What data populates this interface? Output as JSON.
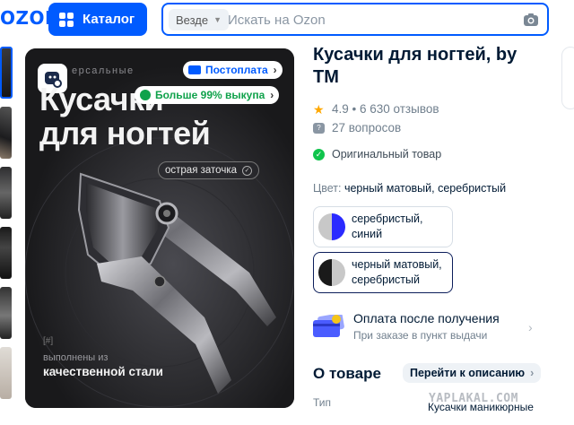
{
  "header": {
    "logo": "OZON",
    "catalog_label": "Каталог",
    "search_scope": "Везде",
    "search_placeholder": "Искать на Ozon"
  },
  "hero": {
    "subtitle": "ерсальные",
    "title_line1": "Кусачки",
    "title_line2": "для ногтей",
    "postpay_badge": "Постоплата",
    "buyout_badge": "Больше 99% выкупа",
    "feature_pill": "острая заточка",
    "mark": "[#]",
    "made_of": "выполнены из",
    "material": "качественной стали"
  },
  "product": {
    "title": "Кусачки для ногтей, by TM",
    "rating": "4.9 • 6 630 отзывов",
    "questions": "27 вопросов",
    "original": "Оригинальный товар",
    "color_label": "Цвет:",
    "color_value": "черный матовый, серебристый",
    "variants": [
      {
        "label": "серебристый, синий",
        "colors": [
          "#c8c8c8",
          "#2a2aff"
        ]
      },
      {
        "label": "черный матовый, серебристый",
        "colors": [
          "#1a1a1a",
          "#c8c8c8"
        ]
      }
    ],
    "postpay_title": "Оплата после получения",
    "postpay_sub": "При заказе в пункт выдачи",
    "about_title": "О товаре",
    "goto_description": "Перейти к описанию",
    "spec_label": "Тип",
    "spec_value": "Кусачки маникюрные"
  },
  "watermark": "YAPLAKAL.COM",
  "colors": {
    "accent": "#005bff",
    "success": "#10c44c",
    "rating_star": "#ffa800"
  }
}
